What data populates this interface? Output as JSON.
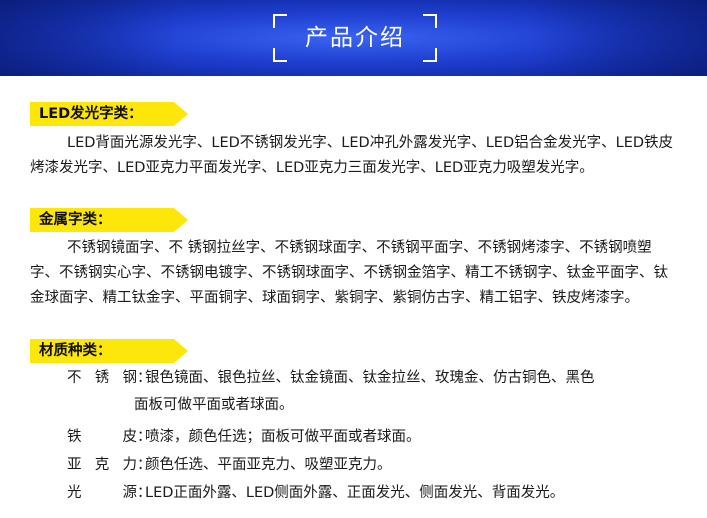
{
  "header": {
    "title": "产品介绍",
    "colors": {
      "banner": "#1f3fd0",
      "accent": "#fde60a"
    }
  },
  "sections": [
    {
      "label": "LED发光字类：",
      "text": "LED背面光源发光字、LED不锈钢发光字、LED冲孔外露发光字、LED铝合金发光字、LED铁皮烤漆发光字、LED亚克力平面发光字、LED亚克力三面发光字、LED亚克力吸塑发光字。"
    },
    {
      "label": "金属字类：",
      "text": "不锈钢镜面字、不 锈钢拉丝字、不锈钢球面字、不锈钢平面字、不锈钢烤漆字、不锈钢喷塑字、不锈钢实心字、不锈钢电镀字、不锈钢球面字、不锈钢金箔字、精工不锈钢字、钛金平面字、钛金球面字、精工钛金字、平面铜字、球面铜字、紫铜字、紫铜仿古字、精工铝字、铁皮烤漆字。"
    },
    {
      "label": "材质种类：",
      "rows": [
        {
          "name": "不锈钢",
          "value": "银色镜面、银色拉丝、钛金镜面、钛金拉丝、玫瑰金、仿古铜色、黑色",
          "value_cont": "面板可做平面或者球面。"
        },
        {
          "name": "铁皮",
          "value": "喷漆，颜色任选；面板可做平面或者球面。"
        },
        {
          "name": "亚克力",
          "value": "颜色任选、平面亚克力、吸塑亚克力。"
        },
        {
          "name": "光源",
          "value": "LED正面外露、LED侧面外露、正面发光、侧面发光、背面发光。"
        }
      ]
    }
  ]
}
